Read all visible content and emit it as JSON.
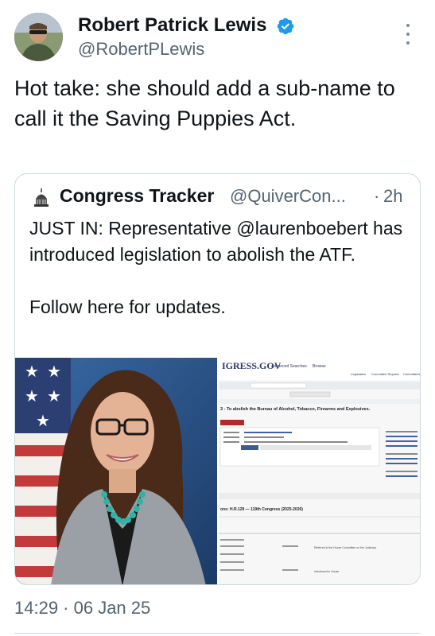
{
  "tweet": {
    "author_name": "Robert Patrick Lewis",
    "author_handle": "@RobertPLewis",
    "text": "Hot take: she should add a sub-name to call it the Saving Puppies Act.",
    "timestamp": "14:29 · 06 Jan 25"
  },
  "quoted_tweet": {
    "author_name": "Congress Tracker",
    "author_handle": "@QuiverCon...",
    "dot": "·",
    "time": "2h",
    "text_line1": "JUST IN: Representative @laurenboebert has introduced legislation to abolish the ATF.",
    "text_line2": "Follow here for updates."
  },
  "screenshot_media": {
    "site_logo": "IGRESS.GOV",
    "nav_advanced": "Advanced Searches",
    "nav_browse": "Browse",
    "nav_legislation": "Legislation",
    "nav_committee": "Committee Reports",
    "nav_congressional": "Committees",
    "bill_title": "3 - To abolish the Bureau of Alcohol, Tobacco, Firearms and Explosives.",
    "actions_heading": "ons: H.R.129 — 119th Congress (2025-2026)",
    "action_note": "Referred to the House Committee on the Judiciary.",
    "action_note2": "Introduced in House"
  },
  "colors": {
    "verified": "#1d9bf0",
    "secondary_text": "#536471",
    "border": "#cfd9de"
  },
  "icons": [
    "verified-badge-icon",
    "more-options-icon",
    "capitol-dome-icon"
  ]
}
